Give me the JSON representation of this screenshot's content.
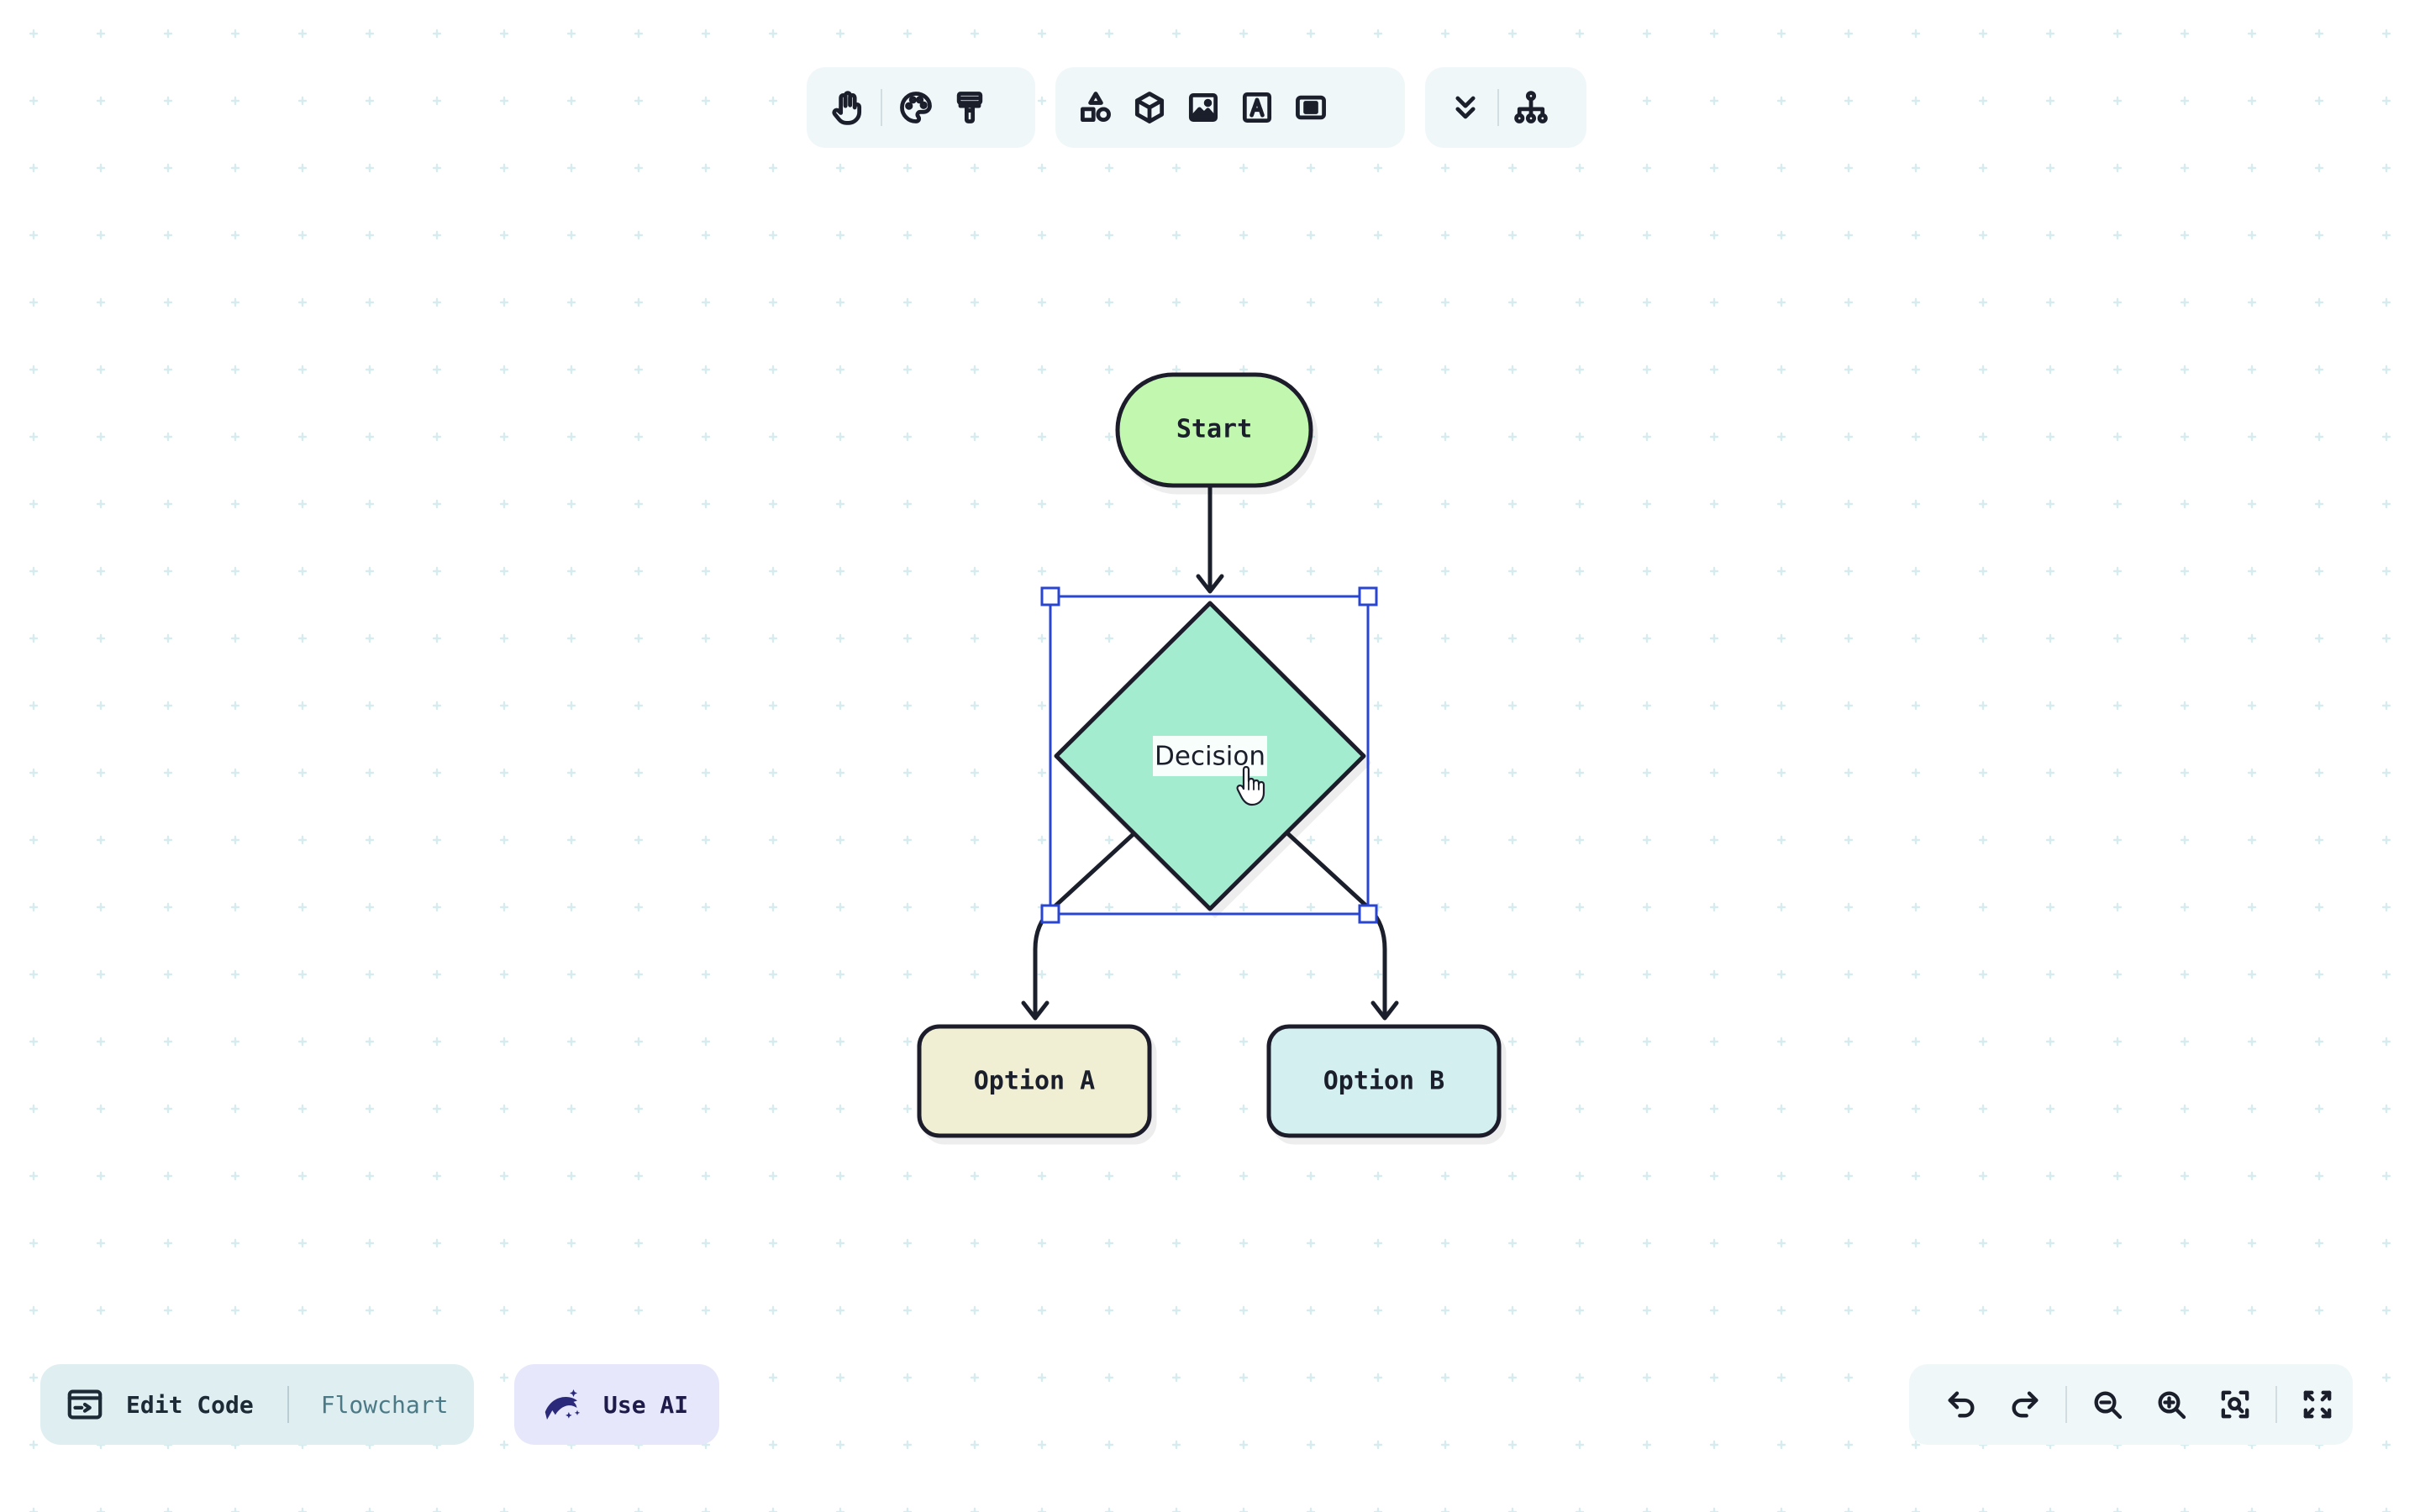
{
  "toolbar": {
    "groups": [
      {
        "name": "navigation",
        "tools": [
          "hand-icon",
          "palette-icon",
          "paint-roller-icon"
        ]
      },
      {
        "name": "insert",
        "tools": [
          "shapes-icon",
          "cube-icon",
          "image-icon",
          "text-icon",
          "frame-icon"
        ]
      },
      {
        "name": "misc",
        "tools": [
          "chevrons-down-icon",
          "hierarchy-icon"
        ]
      }
    ]
  },
  "diagram": {
    "nodes": {
      "start": {
        "label": "Start",
        "fill": "#c1f7ae"
      },
      "decision": {
        "label": "Decision",
        "fill": "#a4ecd0",
        "selected": true
      },
      "option_a": {
        "label": "Option A",
        "fill": "#f1efd3"
      },
      "option_b": {
        "label": "Option B",
        "fill": "#d3eff0"
      }
    },
    "selection_color": "#2945d2",
    "edges": [
      {
        "from": "start",
        "to": "decision"
      },
      {
        "from": "decision",
        "to": "option_a"
      },
      {
        "from": "decision",
        "to": "option_b"
      }
    ]
  },
  "bottom_left": {
    "edit_code_label": "Edit Code",
    "diagram_type": "Flowchart",
    "use_ai_label": "Use AI"
  },
  "bottom_right": {
    "tools": [
      "undo-icon",
      "redo-icon",
      "zoom-out-icon",
      "zoom-in-icon",
      "zoom-fit-icon",
      "fullscreen-icon"
    ]
  },
  "colors": {
    "background_dots": "#d7ecee",
    "stroke": "#1a1f2b",
    "toolbar_bg": "#f0f7f9"
  }
}
